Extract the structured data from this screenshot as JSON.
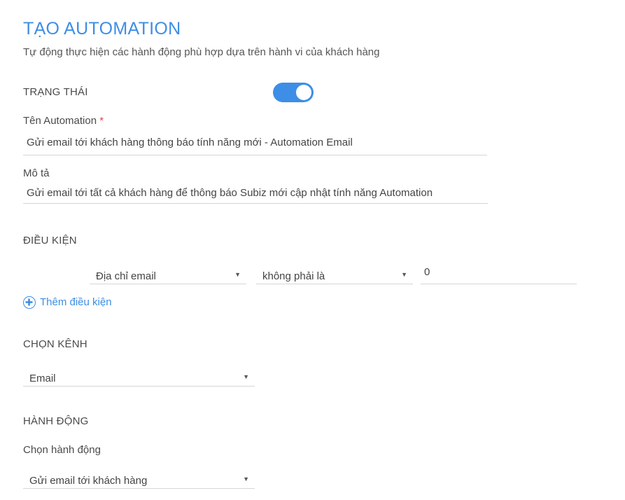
{
  "header": {
    "title": "TẠO AUTOMATION",
    "subtitle": "Tự động thực hiện các hành động phù hợp dựa trên hành vi của khách hàng"
  },
  "status": {
    "label": "TRẠNG THÁI",
    "enabled": true
  },
  "name_field": {
    "label": "Tên Automation",
    "required_mark": "*",
    "value": "Gửi email tới khách hàng thông báo tính năng mới - Automation Email"
  },
  "description_field": {
    "label": "Mô tả",
    "value": "Gửi email tới tất cả khách hàng để thông báo Subiz mới cập nhật tính năng Automation"
  },
  "conditions": {
    "label": "ĐIỀU KIỆN",
    "rows": [
      {
        "attribute": "Địa chỉ email",
        "operator": "không phải là",
        "value": "0"
      }
    ],
    "add_label": "Thêm điều kiện"
  },
  "channel": {
    "label": "CHỌN KÊNH",
    "selected": "Email"
  },
  "action": {
    "label": "HÀNH ĐỘNG",
    "select_label": "Chọn hành động",
    "selected": "Gửi email tới khách hàng"
  },
  "colors": {
    "accent": "#3d8ee6",
    "required": "#e0474c"
  },
  "icons": {
    "dropdown": "caret-down-icon",
    "add": "plus-circle-icon"
  }
}
